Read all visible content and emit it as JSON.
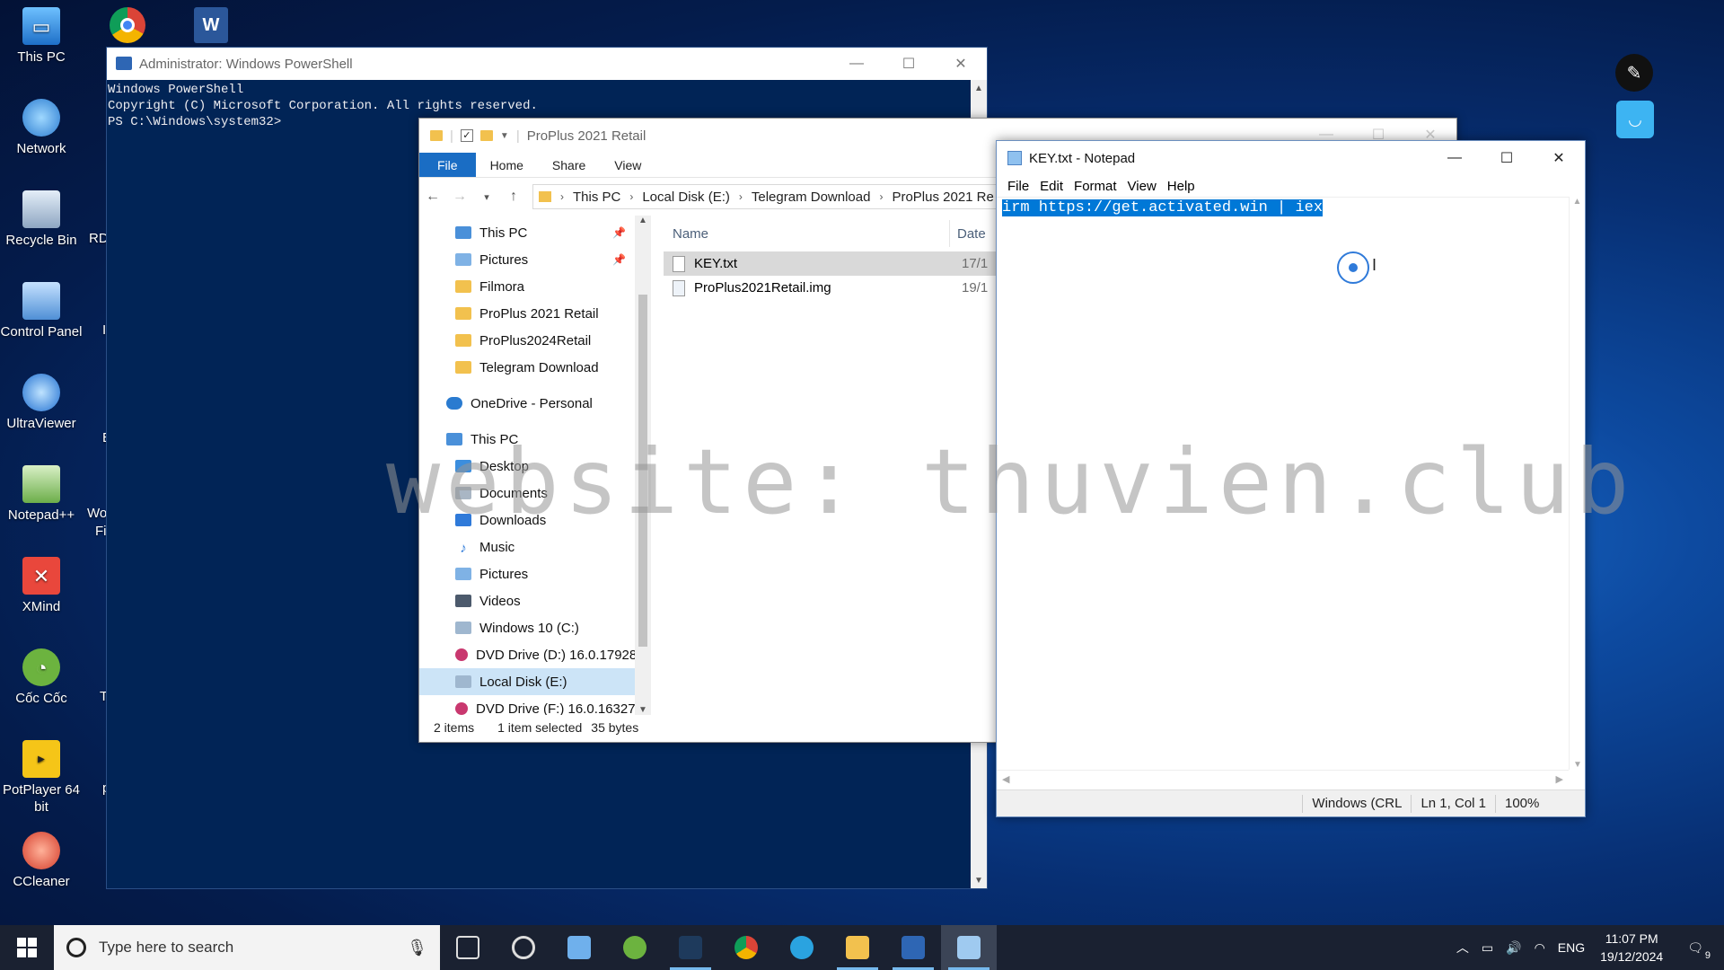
{
  "desktop": {
    "icons": [
      {
        "label": "This PC",
        "icon": "this-pc-icon"
      },
      {
        "label": "Network",
        "icon": "network-icon"
      },
      {
        "label": "Recycle Bin",
        "icon": "recycle-bin-icon"
      },
      {
        "label": "Control Panel",
        "icon": "control-panel-icon"
      },
      {
        "label": "UltraViewer",
        "icon": "ultraviewer-icon"
      },
      {
        "label": "Notepad++",
        "icon": "notepadpp-icon"
      },
      {
        "label": "XMind",
        "icon": "xmind-icon"
      },
      {
        "label": "Cốc Cốc",
        "icon": "coccoc-icon"
      },
      {
        "label": "PotPlayer 64 bit",
        "icon": "potplayer-icon"
      },
      {
        "label": "CCleaner",
        "icon": "ccleaner-icon"
      }
    ],
    "top_icons": [
      "chrome-icon",
      "word-icon"
    ],
    "partial_labels": [
      "RD",
      "Wo",
      "Fi",
      "T",
      "p",
      "I",
      "E"
    ]
  },
  "powershell": {
    "title": "Administrator: Windows PowerShell",
    "lines": [
      "Windows PowerShell",
      "Copyright (C) Microsoft Corporation. All rights reserved.",
      "",
      "PS C:\\Windows\\system32>"
    ]
  },
  "explorer": {
    "title": "ProPlus 2021 Retail",
    "ribbon_tabs": [
      "File",
      "Home",
      "Share",
      "View"
    ],
    "breadcrumb": [
      "This PC",
      "Local Disk (E:)",
      "Telegram Download",
      "ProPlus 2021 Re"
    ],
    "nav_items": [
      {
        "label": "This PC",
        "pinned": true,
        "icon": "this-pc-icon"
      },
      {
        "label": "Pictures",
        "pinned": true,
        "icon": "pictures-icon"
      },
      {
        "label": "Filmora",
        "pinned": false,
        "icon": "folder-icon"
      },
      {
        "label": "ProPlus 2021 Retail",
        "pinned": false,
        "icon": "folder-icon"
      },
      {
        "label": "ProPlus2024Retail",
        "pinned": false,
        "icon": "folder-icon"
      },
      {
        "label": "Telegram Download",
        "pinned": false,
        "icon": "folder-icon"
      },
      {
        "label": "OneDrive - Personal",
        "pinned": false,
        "icon": "onedrive-icon"
      },
      {
        "label": "This PC",
        "pinned": false,
        "icon": "this-pc-icon"
      },
      {
        "label": "Desktop",
        "pinned": false,
        "icon": "desktop-folder-icon"
      },
      {
        "label": "Documents",
        "pinned": false,
        "icon": "documents-icon"
      },
      {
        "label": "Downloads",
        "pinned": false,
        "icon": "downloads-icon"
      },
      {
        "label": "Music",
        "pinned": false,
        "icon": "music-icon"
      },
      {
        "label": "Pictures",
        "pinned": false,
        "icon": "pictures-icon"
      },
      {
        "label": "Videos",
        "pinned": false,
        "icon": "videos-icon"
      },
      {
        "label": "Windows 10 (C:)",
        "pinned": false,
        "icon": "drive-icon"
      },
      {
        "label": "DVD Drive (D:) 16.0.17928",
        "pinned": false,
        "icon": "dvd-icon"
      },
      {
        "label": "Local Disk (E:)",
        "pinned": false,
        "icon": "drive-icon",
        "selected": true
      },
      {
        "label": "DVD Drive (F:) 16.0.16327.",
        "pinned": false,
        "icon": "dvd-icon"
      }
    ],
    "columns": {
      "name": "Name",
      "date": "Date"
    },
    "files": [
      {
        "name": "KEY.txt",
        "date": "17/1",
        "selected": true
      },
      {
        "name": "ProPlus2021Retail.img",
        "date": "19/1",
        "selected": false
      }
    ],
    "status": {
      "items": "2 items",
      "selected": "1 item selected",
      "size": "35 bytes"
    }
  },
  "notepad": {
    "title": "KEY.txt - Notepad",
    "menu": [
      "File",
      "Edit",
      "Format",
      "View",
      "Help"
    ],
    "content": "irm https://get.activated.win | iex",
    "status": {
      "encoding": "Windows (CRL",
      "position": "Ln 1, Col 1",
      "zoom": "100%"
    }
  },
  "watermark": "website: thuvien.club",
  "taskbar": {
    "search_placeholder": "Type here to search",
    "apps": [
      "task-view-icon",
      "lens-icon",
      "control-panel-icon",
      "coccoc-icon",
      "terminal-icon",
      "chrome-icon",
      "telegram-icon",
      "file-explorer-icon",
      "powershell-icon",
      "notepad-icon"
    ],
    "language": "ENG",
    "time": "11:07 PM",
    "date": "19/12/2024",
    "notification_count": "9"
  }
}
